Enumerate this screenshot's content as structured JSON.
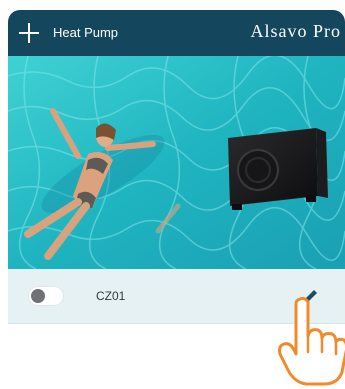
{
  "header": {
    "title": "Heat Pump",
    "brand": "Alsavo Pro",
    "add_icon": "plus-icon",
    "background_color": "#14465e"
  },
  "hero": {
    "content": "photo of woman floating in swimming pool with heat pump unit",
    "pool_color": "#2ec4c9"
  },
  "device_row": {
    "toggle_state": "off",
    "device_name": "CZ01",
    "edit_icon": "pencil-icon",
    "background_color": "#e6f1f3"
  },
  "overlay": {
    "pointer_icon": "hand-pointer-icon",
    "pointer_color": "#f08a2b"
  }
}
